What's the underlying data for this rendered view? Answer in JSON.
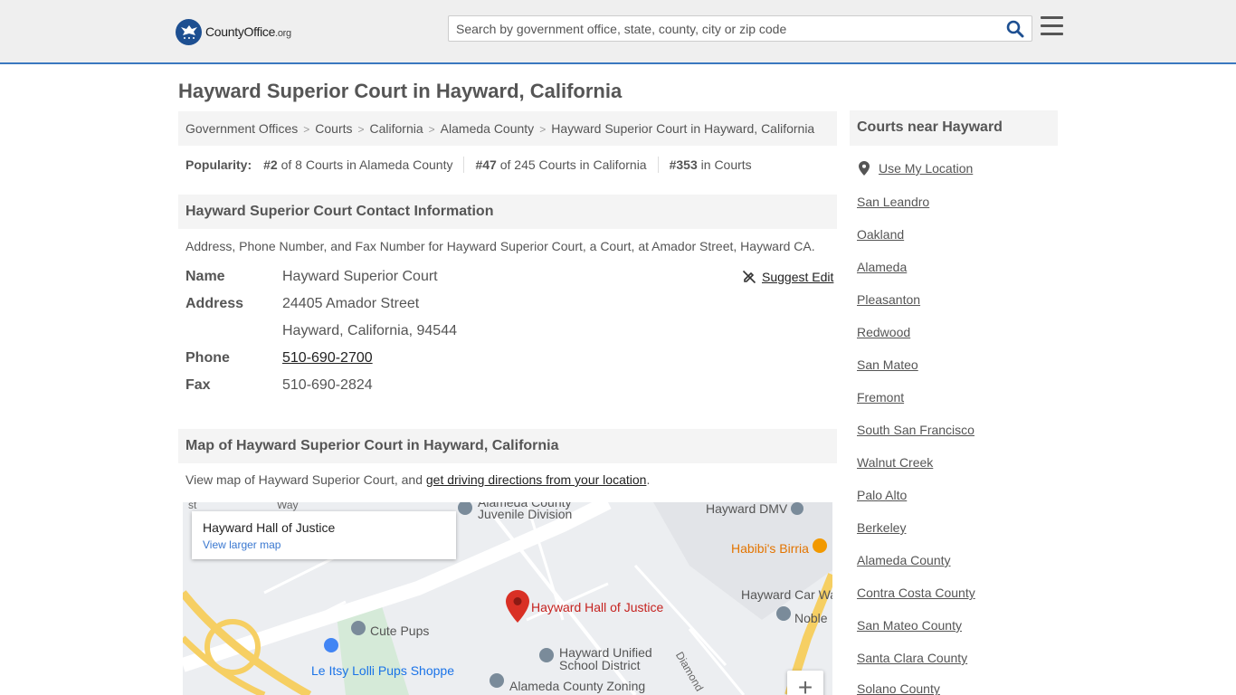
{
  "header": {
    "logo_name": "CountyOffice",
    "logo_tld": ".org",
    "search_placeholder": "Search by government office, state, county, city or zip code"
  },
  "page_title": "Hayward Superior Court in Hayward, California",
  "breadcrumb": [
    "Government Offices",
    "Courts",
    "California",
    "Alameda County",
    "Hayward Superior Court in Hayward, California"
  ],
  "popularity": {
    "label": "Popularity:",
    "items": [
      {
        "rank": "#2",
        "text": "of 8 Courts in Alameda County"
      },
      {
        "rank": "#47",
        "text": "of 245 Courts in California"
      },
      {
        "rank": "#353",
        "text": "in Courts"
      }
    ]
  },
  "contact": {
    "heading": "Hayward Superior Court Contact Information",
    "description": "Address, Phone Number, and Fax Number for Hayward Superior Court, a Court, at Amador Street, Hayward CA.",
    "suggest_edit": "Suggest Edit",
    "name_label": "Name",
    "name": "Hayward Superior Court",
    "address_label": "Address",
    "address_line1": "24405 Amador Street",
    "address_line2": "Hayward, California, 94544",
    "phone_label": "Phone",
    "phone": "510-690-2700",
    "fax_label": "Fax",
    "fax": "510-690-2824"
  },
  "map_section": {
    "heading": "Map of Hayward Superior Court in Hayward, California",
    "desc_prefix": "View map of Hayward Superior Court, and ",
    "desc_link": "get driving directions from your location",
    "desc_suffix": ".",
    "card_title": "Hayward Hall of Justice",
    "card_link": "View larger map",
    "labels": {
      "marker": "Hayward Hall of Justice",
      "dmv": "Hayward DMV",
      "birria": "Habibi's Birria",
      "carwash": "Hayward Car Wa",
      "noble": "Noble",
      "cute_pups": "Cute Pups",
      "le_itsy": "Le Itsy Lolli Pups Shoppe",
      "husd_1": "Hayward Unified",
      "husd_2": "School District",
      "zoning": "Alameda County Zoning",
      "juvenile_1": "Alameda County",
      "juvenile_2": "Juvenile Division",
      "diamond": "Diamond",
      "st": "st",
      "way": "Way"
    },
    "zoom_in": "+"
  },
  "sidebar": {
    "heading": "Courts near Hayward",
    "use_location": "Use My Location",
    "items": [
      "San Leandro",
      "Oakland",
      "Alameda",
      "Pleasanton",
      "Redwood",
      "San Mateo",
      "Fremont",
      "South San Francisco",
      "Walnut Creek",
      "Palo Alto",
      "Berkeley",
      "Alameda County",
      "Contra Costa County",
      "San Mateo County",
      "Santa Clara County",
      "Solano County"
    ]
  },
  "colors": {
    "accent": "#3a78bf",
    "logo_blue": "#1d4f91",
    "panel_bg": "#f4f4f4",
    "marker_red": "#d93025"
  }
}
